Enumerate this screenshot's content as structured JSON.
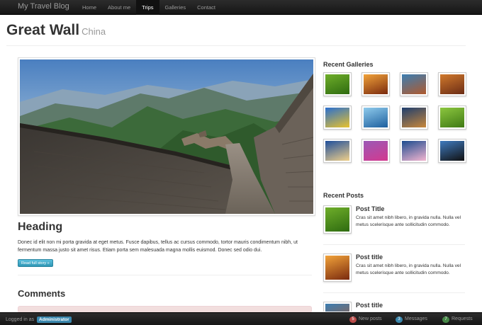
{
  "navbar": {
    "brand": "My Travel Blog",
    "items": [
      {
        "label": "Home",
        "active": false
      },
      {
        "label": "About me",
        "active": false
      },
      {
        "label": "Trips",
        "active": true
      },
      {
        "label": "Galleries",
        "active": false
      },
      {
        "label": "Contact",
        "active": false
      }
    ]
  },
  "header": {
    "title": "Great Wall",
    "subtitle": "China"
  },
  "main": {
    "hero_image": "great-wall-photo",
    "heading": "Heading",
    "body": "Donec id elit non mi porta gravida at eget metus. Fusce dapibus, tellus ac cursus commodo, tortor mauris condimentum nibh, ut fermentum massa justo sit amet risus. Etiam porta sem malesuada magna mollis euismod. Donec sed odio dui.",
    "button": "Read full story »",
    "comments_title": "Comments"
  },
  "sidebar": {
    "galleries_title": "Recent Galleries",
    "galleries": [
      {
        "name": "green-leaf-thumb",
        "colors": [
          "#6fae2a",
          "#2e6b10"
        ]
      },
      {
        "name": "sunset-sea-thumb",
        "colors": [
          "#f2a33a",
          "#7a2a0e"
        ]
      },
      {
        "name": "coast-rocks-thumb",
        "colors": [
          "#3b7eb3",
          "#b05a2e"
        ]
      },
      {
        "name": "autumn-tree-thumb",
        "colors": [
          "#d1792c",
          "#6b2c15"
        ]
      },
      {
        "name": "yellow-flowers-thumb",
        "colors": [
          "#2a6fcf",
          "#e8c22c"
        ]
      },
      {
        "name": "water-drop-thumb",
        "colors": [
          "#8fcbec",
          "#1d5f9e"
        ]
      },
      {
        "name": "dusk-landscape-thumb",
        "colors": [
          "#1e3e6e",
          "#c8873a"
        ]
      },
      {
        "name": "green-grass-thumb",
        "colors": [
          "#8cc63f",
          "#3f7a14"
        ]
      },
      {
        "name": "blue-sky-thumb",
        "colors": [
          "#1f4f9c",
          "#f0d08a"
        ]
      },
      {
        "name": "purple-flower-thumb",
        "colors": [
          "#9b59b6",
          "#d3398f"
        ]
      },
      {
        "name": "pink-blossom-thumb",
        "colors": [
          "#1d4c8f",
          "#f3b6d0"
        ]
      },
      {
        "name": "dark-tree-thumb",
        "colors": [
          "#3f7bbf",
          "#111111"
        ]
      }
    ],
    "posts_title": "Recent Posts",
    "posts": [
      {
        "title": "Post Title",
        "text": "Cras sit amet nibh libero, in gravida nulla. Nulla vel metus scelerisque ante sollicitudin commodo.",
        "thumb": "green-leaf-thumb",
        "colors": [
          "#6fae2a",
          "#2e6b10"
        ]
      },
      {
        "title": "Post title",
        "text": "Cras sit amet nibh libero, in gravida nulla. Nulla vel metus scelerisque ante sollicitudin commodo.",
        "thumb": "sunset-sea-thumb",
        "colors": [
          "#f2a33a",
          "#7a2a0e"
        ]
      },
      {
        "title": "Post title",
        "text": "",
        "thumb": "coast-rocks-thumb",
        "colors": [
          "#3b7eb3",
          "#b05a2e"
        ]
      }
    ]
  },
  "bottombar": {
    "logged_in_prefix": "Logged in as",
    "user": "Administrator",
    "stats": [
      {
        "count": "5",
        "label": "New posts",
        "color": "#b94a48"
      },
      {
        "count": "3",
        "label": "Messages",
        "color": "#3a87ad"
      },
      {
        "count": "7",
        "label": "Requests",
        "color": "#468847"
      }
    ]
  }
}
